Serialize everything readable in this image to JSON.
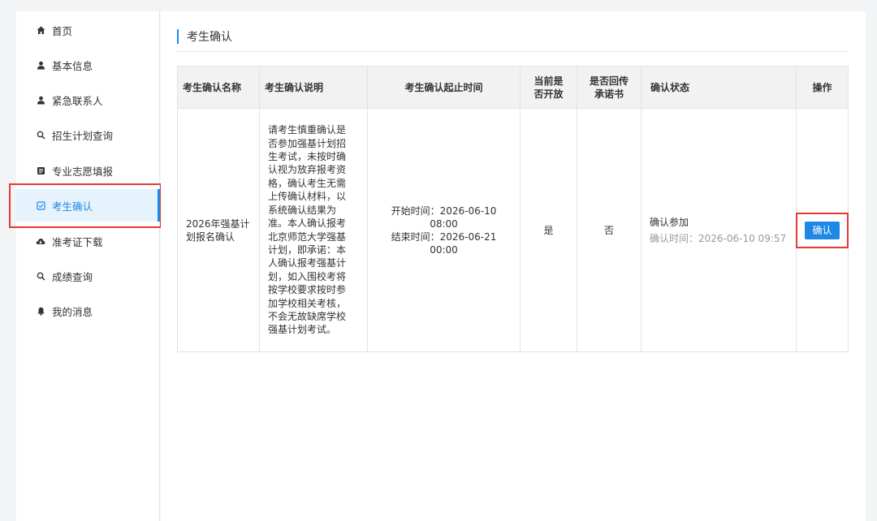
{
  "colors": {
    "accent": "#1e88e5",
    "highlight": "#e53935"
  },
  "sidebar": {
    "items": [
      {
        "label": "首页",
        "icon": "home-icon",
        "active": false
      },
      {
        "label": "基本信息",
        "icon": "user-icon",
        "active": false
      },
      {
        "label": "紧急联系人",
        "icon": "user-icon",
        "active": false
      },
      {
        "label": "招生计划查询",
        "icon": "search-icon",
        "active": false
      },
      {
        "label": "专业志愿填报",
        "icon": "form-icon",
        "active": false
      },
      {
        "label": "考生确认",
        "icon": "checkbox-icon",
        "active": true
      },
      {
        "label": "准考证下载",
        "icon": "cloud-download-icon",
        "active": false
      },
      {
        "label": "成绩查询",
        "icon": "search-icon",
        "active": false
      },
      {
        "label": "我的消息",
        "icon": "bell-icon",
        "active": false
      }
    ]
  },
  "main": {
    "title": "考生确认",
    "table": {
      "headers": {
        "name": "考生确认名称",
        "desc": "考生确认说明",
        "time": "考生确认起止时间",
        "open_l1": "当前是",
        "open_l2": "否开放",
        "commit_l1": "是否回传",
        "commit_l2": "承诺书",
        "status": "确认状态",
        "op": "操作"
      },
      "row": {
        "name_l1": "2026年强基计",
        "name_l2": "划报名确认",
        "desc": [
          "请考生慎重确认是",
          "否参加强基计划招",
          "生考试，未按时确",
          "认视为放弃报考资",
          "格，确认考生无需",
          "上传确认材料，以",
          "系统确认结果为",
          "准。本人确认报考",
          "北京师范大学强基",
          "计划，即承诺：本",
          "人确认报考强基计",
          "划，如入围校考将",
          "按学校要求按时参",
          "加学校相关考核，",
          "不会无故缺席学校",
          "强基计划考试。"
        ],
        "start_time": "开始时间：2026-06-10 08:00",
        "end_time": "结束时间：2026-06-21 00:00",
        "is_open": "是",
        "commitment_returned": "否",
        "status": "确认参加",
        "status_time": "确认时间：2026-06-10 09:57",
        "action_label": "确认"
      }
    }
  }
}
